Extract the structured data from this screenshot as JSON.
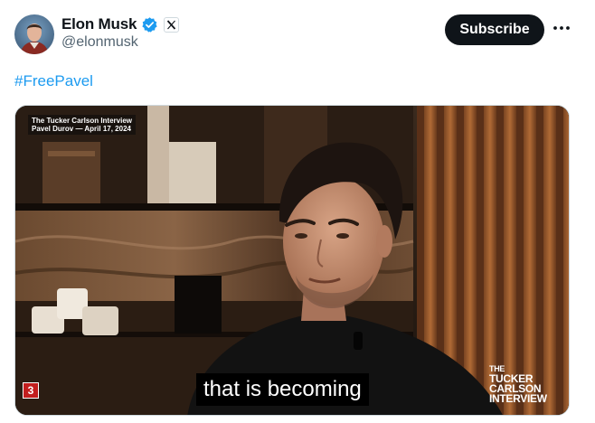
{
  "author": {
    "display_name": "Elon Musk",
    "handle": "@elonmusk",
    "verified_color": "#1d9bf0"
  },
  "actions": {
    "subscribe_label": "Subscribe",
    "more_icon": "more-horizontal-icon"
  },
  "tweet": {
    "text": "#FreePavel"
  },
  "video": {
    "overlay_line1": "The Tucker Carlson Interview",
    "overlay_line2": "Pavel Durov — April 17, 2024",
    "caption": "that is becoming",
    "badge": "3",
    "logo_line1": "THE",
    "logo_line2": "TUCKER",
    "logo_line3": "CARLSON",
    "logo_line4": "INTERVIEW"
  },
  "colors": {
    "link": "#1d9bf0",
    "button_bg": "#0f1419",
    "handle_gray": "#536471"
  }
}
